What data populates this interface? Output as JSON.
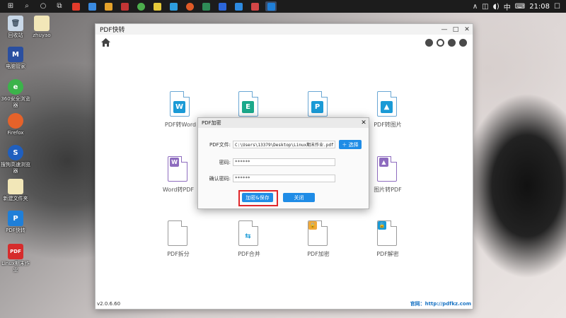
{
  "taskbar": {
    "time": "21:08",
    "tray_lang": "中",
    "search_icon": "search-icon",
    "app_colors": [
      "#e23b2b",
      "#3a8ae0",
      "#e5a22b",
      "#c23535",
      "#4cae4c",
      "#e5c93a",
      "#2d9dde",
      "#df5a27",
      "#2e8b57",
      "#2c66d9",
      "#2d8ae0",
      "#d24646",
      "#1f7fd8"
    ]
  },
  "desktop": {
    "icons": [
      {
        "label": "回收站"
      },
      {
        "label": "zhuyao"
      },
      {
        "label": "电脑管家"
      },
      {
        "label": "360安全浏览器"
      },
      {
        "label": "Firefox"
      },
      {
        "label": "搜狗高速浏览器"
      },
      {
        "label": "新建文件夹"
      },
      {
        "label": "PDF快转"
      },
      {
        "label": "Linux期末作业"
      }
    ]
  },
  "window": {
    "title": "PDF快转",
    "controls": [
      "—",
      "□",
      "✕"
    ],
    "version": "v2.0.6.60",
    "site": "官网：http://pdfkz.com"
  },
  "tools": [
    {
      "label": "PDF转Word",
      "badge": "W",
      "color": "#1a9ad6"
    },
    {
      "label": "",
      "badge": "E",
      "color": "#1aa98b"
    },
    {
      "label": "",
      "badge": "P",
      "color": "#1a9ad6"
    },
    {
      "label": "PDF转图片",
      "badge": "▲",
      "color": "#1a9ad6"
    },
    {
      "label": "Word转PDF",
      "badge": "W",
      "color": "#8e6cbf"
    },
    {
      "label": "图片转PDF",
      "badge": "▲",
      "color": "#8e6cbf"
    },
    {
      "label": "PDF拆分",
      "badge": "",
      "color": "#9a9a9a"
    },
    {
      "label": "PDF合并",
      "badge": "⇆",
      "color": "#1a9ad6"
    },
    {
      "label": "PDF加密",
      "badge": "🔒",
      "color": "#f0a93a"
    },
    {
      "label": "PDF解密",
      "badge": "🔓",
      "color": "#1a9ad6"
    }
  ],
  "dialog": {
    "title": "PDF加密",
    "file_label": "PDF文件:",
    "file_value": "C:\\Users\\13379\\Desktop\\Linux期末作业.pdf",
    "choose_label": "＋ 选择",
    "password_label": "密码:",
    "password_value": "******",
    "confirm_label": "确认密码:",
    "confirm_value": "******",
    "encrypt_button": "加密&保存",
    "close_button": "关闭"
  }
}
